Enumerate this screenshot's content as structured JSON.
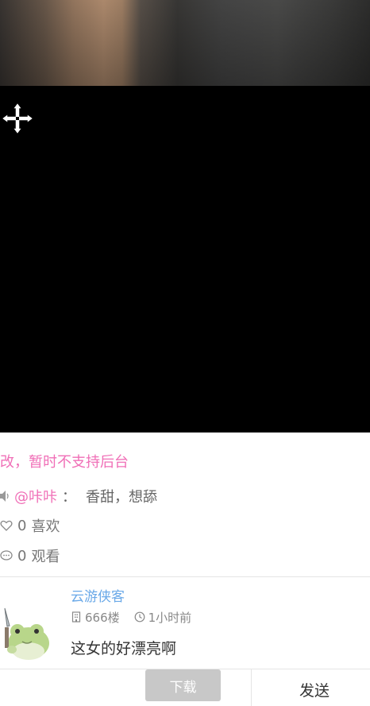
{
  "notice": "改，暂时不支持后台",
  "comment": {
    "mention": "@咔咔",
    "colon": "：",
    "text": "香甜，想舔"
  },
  "stats": {
    "likes_count": "0",
    "likes_label": "喜欢",
    "views_count": "0",
    "views_label": "观看"
  },
  "reply": {
    "username": "云游侠客",
    "floor": "666楼",
    "time": "1小时前",
    "text": "这女的好漂亮啊"
  },
  "bottom_bar": {
    "download_label": "下载",
    "send_label": "发送"
  },
  "colors": {
    "accent_pink": "#f06fb7",
    "username_blue": "#6aa9e8",
    "button_gray": "#c8c8c8"
  },
  "icons": [
    "move-icon",
    "speaker-icon",
    "heart-icon",
    "comment-icon",
    "floor-icon",
    "clock-icon"
  ]
}
